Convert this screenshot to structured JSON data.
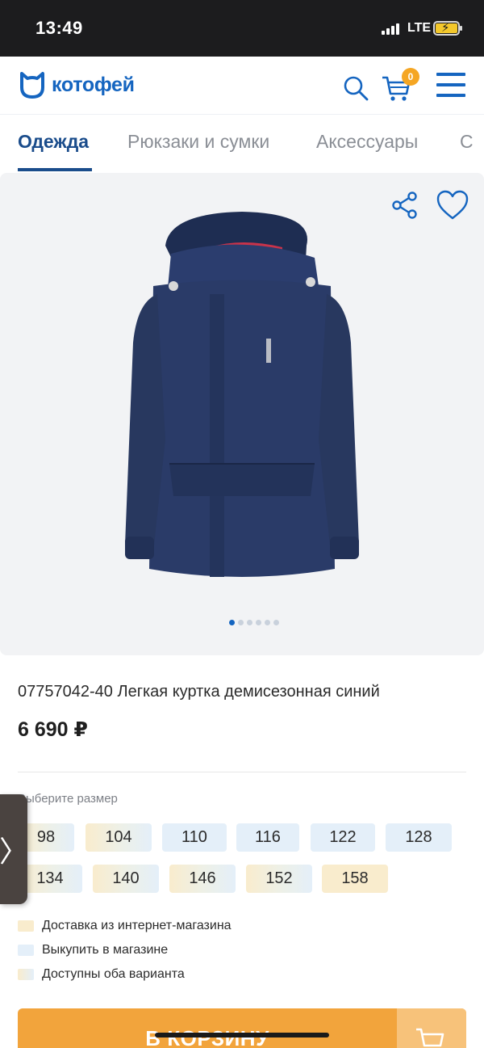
{
  "status_bar": {
    "time": "13:49",
    "network": "LTE"
  },
  "header": {
    "logo_text": "котофей",
    "cart_count": "0"
  },
  "categories": [
    {
      "label": "Одежда"
    },
    {
      "label": "Рюкзаки и сумки"
    },
    {
      "label": "Аксессуары"
    }
  ],
  "gallery": {
    "image_count": 6,
    "active_index": 0
  },
  "product": {
    "title": "07757042-40 Легкая куртка демисезонная синий",
    "price": "6 690 ₽"
  },
  "sizes": {
    "label": "Выберите размер",
    "items": [
      {
        "value": "98",
        "availability": "both"
      },
      {
        "value": "104",
        "availability": "both"
      },
      {
        "value": "110",
        "availability": "store"
      },
      {
        "value": "116",
        "availability": "store"
      },
      {
        "value": "122",
        "availability": "store"
      },
      {
        "value": "128",
        "availability": "store"
      },
      {
        "value": "134",
        "availability": "both"
      },
      {
        "value": "140",
        "availability": "both"
      },
      {
        "value": "146",
        "availability": "both"
      },
      {
        "value": "152",
        "availability": "both"
      },
      {
        "value": "158",
        "availability": "online"
      }
    ]
  },
  "legend": [
    {
      "label": "Доставка из интернет-магазина",
      "type": "online"
    },
    {
      "label": "Выкупить в магазине",
      "type": "store"
    },
    {
      "label": "Доступны оба варианта",
      "type": "both"
    }
  ],
  "add_to_cart_label": "В КОРЗИНУ",
  "colors": {
    "brand_blue": "#1565c0",
    "accent_orange": "#f2a43c",
    "online_yellow": "#f9eccd",
    "store_blue": "#e4eff9"
  }
}
